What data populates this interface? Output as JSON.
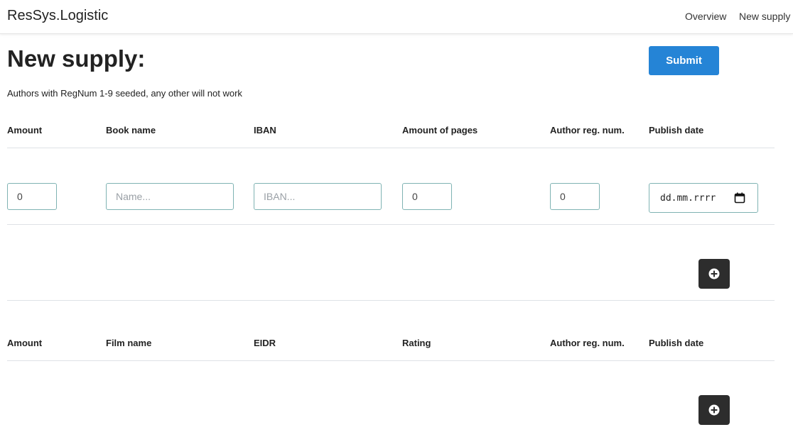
{
  "navbar": {
    "brand": "ResSys.Logistic",
    "links": [
      "Overview",
      "New supply"
    ]
  },
  "page": {
    "title": "New supply:",
    "submit_label": "Submit",
    "note": "Authors with RegNum 1-9 seeded, any other will not work"
  },
  "books": {
    "headers": [
      "Amount",
      "Book name",
      "IBAN",
      "Amount of pages",
      "Author reg. num.",
      "Publish date"
    ],
    "row": {
      "amount": "0",
      "name_placeholder": "Name...",
      "iban_placeholder": "IBAN...",
      "pages": "0",
      "author_reg": "0",
      "date_placeholder": "dd.mm.rrrr"
    },
    "add_icon": "plus-circle-icon"
  },
  "films": {
    "headers": [
      "Amount",
      "Film name",
      "EIDR",
      "Rating",
      "Author reg. num.",
      "Publish date"
    ],
    "add_icon": "plus-circle-icon"
  },
  "colors": {
    "primary": "#2584d6",
    "dark_button": "#2d2d2d",
    "input_border": "#7fb3b3"
  }
}
